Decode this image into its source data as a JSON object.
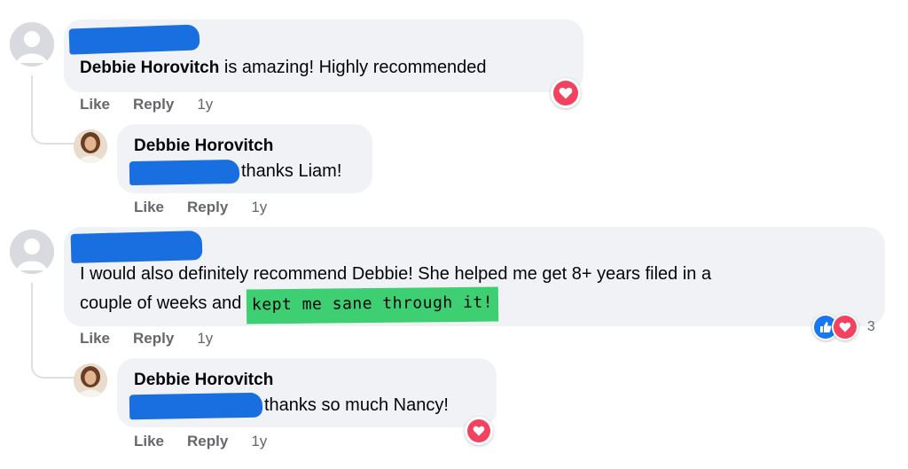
{
  "comments": [
    {
      "author_bold_inline": "Debbie Horovitch",
      "text_after": " is amazing! Highly recommended",
      "actions": {
        "like": "Like",
        "reply": "Reply",
        "time": "1y"
      },
      "reaction": {
        "type": "heart-icon"
      },
      "reply": {
        "author": "Debbie Horovitch",
        "text": "thanks Liam!",
        "actions": {
          "like": "Like",
          "reply": "Reply",
          "time": "1y"
        }
      }
    },
    {
      "text_line1": "I would also definitely recommend Debbie! She helped me get 8+ years filed in a",
      "text_line2_prefix": "couple of weeks and ",
      "highlight_text": "kept me sane through it!",
      "actions": {
        "like": "Like",
        "reply": "Reply",
        "time": "1y"
      },
      "reactions": {
        "icons": [
          "like-icon",
          "heart-icon"
        ],
        "count": "3"
      },
      "reply": {
        "author": "Debbie Horovitch",
        "text": "thanks so much Nancy!",
        "actions": {
          "like": "Like",
          "reply": "Reply",
          "time": "1y"
        },
        "reaction": {
          "type": "heart-icon"
        }
      }
    }
  ],
  "colors": {
    "bubble": "#f0f2f5",
    "meta": "#65676b",
    "redaction": "#1a6fe0",
    "highlight": "#3ecf72",
    "heart": "#f3425f",
    "like": "#1877f2"
  }
}
